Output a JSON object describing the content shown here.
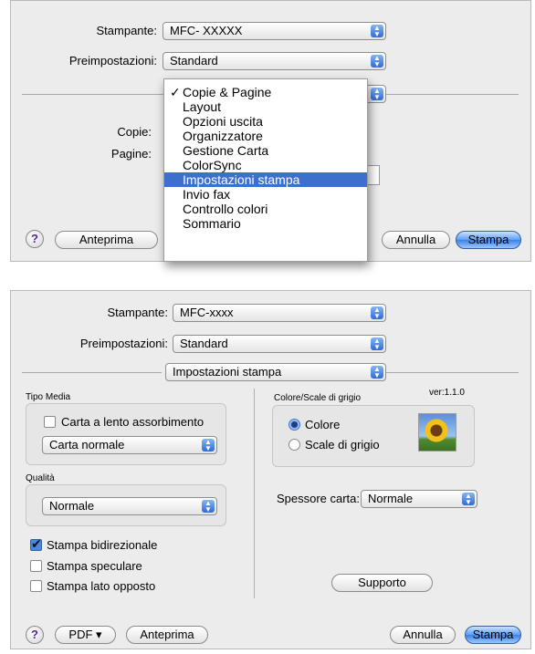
{
  "top": {
    "printer_label": "Stampante:",
    "printer_value": "MFC- XXXXX",
    "presets_label": "Preimpostazioni:",
    "presets_value": "Standard",
    "copies_label": "Copie:",
    "pages_label": "Pagine:",
    "menu_items": [
      {
        "label": "Copie & Pagine",
        "checked": true,
        "selected": false
      },
      {
        "label": "Layout",
        "checked": false,
        "selected": false
      },
      {
        "label": "Opzioni uscita",
        "checked": false,
        "selected": false
      },
      {
        "label": "Organizzatore",
        "checked": false,
        "selected": false
      },
      {
        "label": "Gestione Carta",
        "checked": false,
        "selected": false
      },
      {
        "label": "ColorSync",
        "checked": false,
        "selected": false
      },
      {
        "label": "Impostazioni stampa",
        "checked": false,
        "selected": true
      },
      {
        "label": "Invio fax",
        "checked": false,
        "selected": false
      },
      {
        "label": "Controllo colori",
        "checked": false,
        "selected": false
      },
      {
        "label": "Sommario",
        "checked": false,
        "selected": false
      }
    ],
    "checkmark": "✓",
    "help": "?",
    "preview_button": "Anteprima",
    "cancel_button": "Annulla",
    "print_button": "Stampa"
  },
  "bottom": {
    "printer_label": "Stampante:",
    "printer_value": "MFC-xxxx",
    "presets_label": "Preimpostazioni:",
    "presets_value": "Standard",
    "panel_value": "Impostazioni stampa",
    "media_group_label": "Tipo Media",
    "slow_drying_label": "Carta a lento assorbimento",
    "slow_drying_checked": false,
    "media_type_value": "Carta normale",
    "quality_group_label": "Qualità",
    "quality_value": "Normale",
    "bidirectional_label": "Stampa bidirezionale",
    "bidirectional_checked": true,
    "mirror_label": "Stampa speculare",
    "mirror_checked": false,
    "reverse_label": "Stampa lato opposto",
    "reverse_checked": false,
    "version": "ver:1.1.0",
    "color_group_label": "Colore/Scale di grigio",
    "color_option": "Colore",
    "grayscale_option": "Scale di grigio",
    "color_selected": "Colore",
    "paper_thickness_label": "Spessore carta:",
    "paper_thickness_value": "Normale",
    "support_button": "Supporto",
    "help": "?",
    "pdf_button": "PDF ▾",
    "preview_button": "Anteprima",
    "cancel_button": "Annulla",
    "print_button": "Stampa"
  },
  "icons": {
    "popup_arrows": "⬍",
    "checkbox_mark": "✔"
  }
}
